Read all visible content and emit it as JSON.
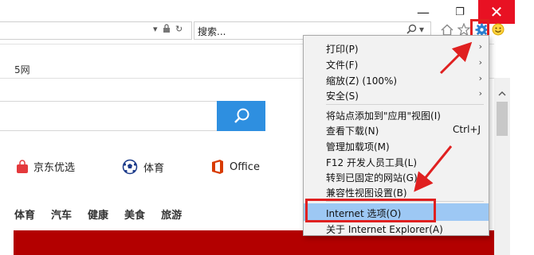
{
  "window": {
    "minimize": "—",
    "maximize": "❐",
    "close": "✕"
  },
  "address_bar": {
    "dropdown": "▾",
    "lock": "🔒",
    "refresh": "↻"
  },
  "search_bar": {
    "value": "搜索...",
    "search_glyph": "⌕",
    "dropdown": "▾"
  },
  "toolbar_icons": [
    "home-icon",
    "favorites-icon",
    "gear-icon",
    "smiley-icon"
  ],
  "page": {
    "crumb": "5网",
    "quick_links": [
      {
        "label": "京东优选",
        "icon": "shopping-bag-icon",
        "color": "#e4393c"
      },
      {
        "label": "体育",
        "icon": "soccer-ball-icon",
        "color": "#1b3a8a"
      },
      {
        "label": "Office",
        "icon": "office-icon",
        "color": "#d83b01"
      }
    ],
    "categories": [
      "体育",
      "汽车",
      "健康",
      "美食",
      "旅游"
    ],
    "accent": "#2e8fe0",
    "banner_color": "#b30000"
  },
  "menu": {
    "items": [
      {
        "label": "打印(P)",
        "submenu": true
      },
      {
        "label": "文件(F)",
        "submenu": true
      },
      {
        "label": "缩放(Z) (100%)",
        "submenu": true
      },
      {
        "label": "安全(S)",
        "submenu": true
      },
      {
        "label": "将站点添加到\"应用\"视图(I)"
      },
      {
        "label": "查看下载(N)",
        "accel": "Ctrl+J"
      },
      {
        "label": "管理加载项(M)"
      },
      {
        "label": "F12 开发人员工具(L)"
      },
      {
        "label": "转到已固定的网站(G)"
      },
      {
        "label": "兼容性视图设置(B)"
      },
      {
        "label": "Internet 选项(O)",
        "highlighted": true
      },
      {
        "label": "关于 Internet Explorer(A)"
      }
    ],
    "submenu_arrow": "›"
  },
  "annotation_color": "#e02020"
}
